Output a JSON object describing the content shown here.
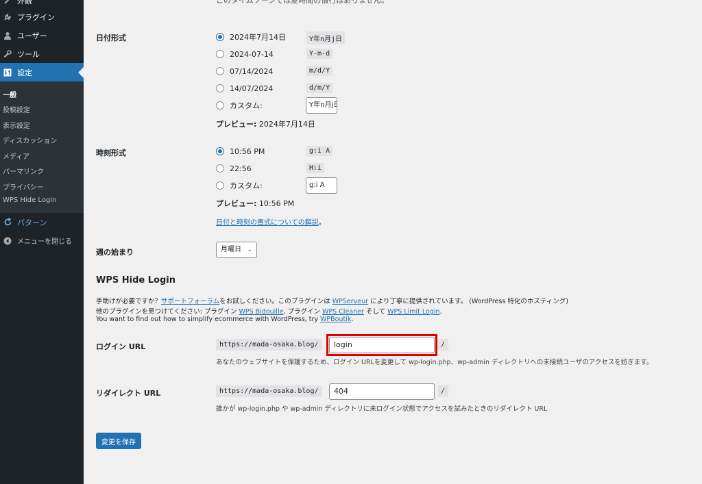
{
  "sidebar": {
    "items": [
      {
        "label": "外観",
        "icon": "brush-icon"
      },
      {
        "label": "プラグイン",
        "icon": "plugin-icon"
      },
      {
        "label": "ユーザー",
        "icon": "user-icon"
      },
      {
        "label": "ツール",
        "icon": "wrench-icon"
      },
      {
        "label": "設定",
        "icon": "settings-icon"
      }
    ],
    "submenu": [
      "一般",
      "投稿設定",
      "表示設定",
      "ディスカッション",
      "メディア",
      "パーマリンク",
      "プライバシー",
      "WPS Hide Login"
    ],
    "pattern_label": "パターン",
    "collapse_label": "メニューを閉じる"
  },
  "timezone_note": "このタイムゾーンでは夏時間の慣行はありません。",
  "date_format": {
    "label": "日付形式",
    "options": [
      {
        "text": "2024年7月14日",
        "code": "Y年n月j日",
        "checked": true
      },
      {
        "text": "2024-07-14",
        "code": "Y-m-d"
      },
      {
        "text": "07/14/2024",
        "code": "m/d/Y"
      },
      {
        "text": "14/07/2024",
        "code": "d/m/Y"
      }
    ],
    "custom_label": "カスタム:",
    "custom_value": "Y年n月j日",
    "preview_label": "プレビュー:",
    "preview_value": "2024年7月14日"
  },
  "time_format": {
    "label": "時刻形式",
    "options": [
      {
        "text": "10:56 PM",
        "code": "g:i A",
        "checked": true
      },
      {
        "text": "22:56",
        "code": "H:i"
      }
    ],
    "custom_label": "カスタム:",
    "custom_value": "g:i A",
    "preview_label": "プレビュー:",
    "preview_value": "10:56 PM",
    "doc_link": "日付と時刻の書式についての解説"
  },
  "week_start": {
    "label": "週の始まり",
    "value": "月曜日"
  },
  "wps": {
    "title": "WPS Hide Login",
    "help1_pre": "手助けが必要ですか？",
    "help1_link1": "サポートフォーラム",
    "help1_mid": "をお試しください。このプラグインは ",
    "help1_link2": "WPServeur",
    "help1_post": " により丁寧に提供されています。 (WordPress 特化のホスティング)",
    "help2_pre": "他のプラグインを見つけてください: プラグイン ",
    "help2_link1": "WPS Bidouille",
    "help2_mid1": ", プラグイン ",
    "help2_link2": "WPS Cleaner",
    "help2_mid2": " そして ",
    "help2_link3": "WPS Limit Login",
    "help3_pre": "You want to find out how to simplify ecommerce with WordPress, try ",
    "help3_link": "WPBoutik",
    "login_label": "ログイン URL",
    "url_prefix": "https://mada-osaka.blog/",
    "login_value": "login",
    "slash": "/",
    "login_desc": "あなたのウェブサイトを保護するため、ログイン URLを変更して wp-login.php、wp-admin ディレクトリへの未接続ユーザのアクセスを妨ぎます。",
    "redirect_label": "リダイレクト URL",
    "redirect_value": "404",
    "redirect_desc": "誰かが wp-login.php や wp-admin ディレクトリに未ログイン状態でアクセスを試みたときのリダイレクト URL"
  },
  "save_label": "変更を保存",
  "colors": {
    "accent": "#2271b1",
    "highlight": "#e00000",
    "sidebar": "#1d2327"
  }
}
